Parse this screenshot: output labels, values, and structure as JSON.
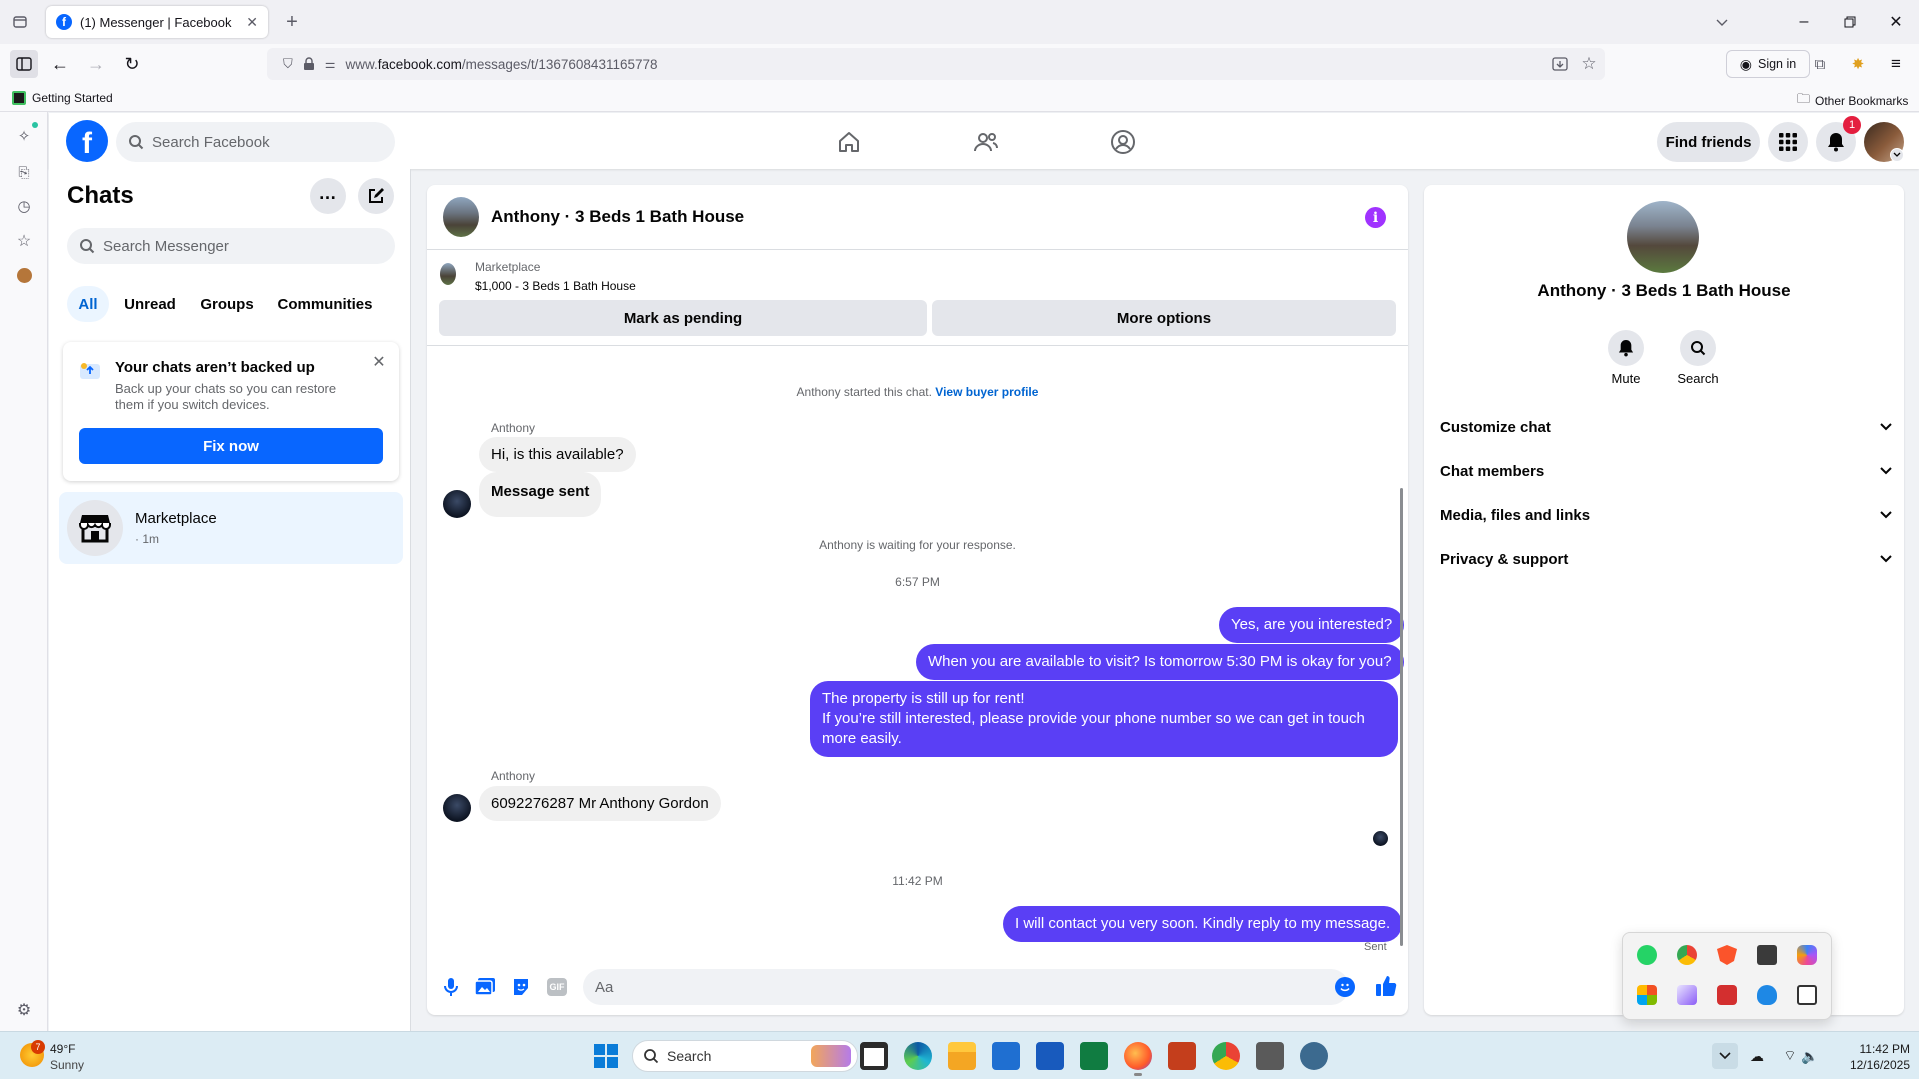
{
  "browser": {
    "tab_title": "(1) Messenger | Facebook",
    "url_prefix": "www.",
    "url_host": "facebook.com",
    "url_path": "/messages/t/1367608431165778",
    "sign_in": "Sign in",
    "bookmark_getting_started": "Getting Started",
    "bookmark_other": "Other Bookmarks"
  },
  "fb_header": {
    "search_placeholder": "Search Facebook",
    "find_friends": "Find friends",
    "notification_count": "1"
  },
  "chats": {
    "title": "Chats",
    "search_placeholder": "Search Messenger",
    "filters": [
      "All",
      "Unread",
      "Groups",
      "Communities"
    ],
    "backup_card": {
      "title": "Your chats aren’t backed up",
      "description": "Back up your chats so you can restore them if you switch devices.",
      "button": "Fix now"
    },
    "list": [
      {
        "name": "Marketplace",
        "meta": "· 1m"
      }
    ]
  },
  "conversation": {
    "title": "Anthony · 3 Beds 1 Bath House",
    "marketplace_label": "Marketplace",
    "listing": "$1,000 - 3 Beds 1 Bath House",
    "mark_pending": "Mark as pending",
    "more_options": "More options",
    "started_text": "Anthony started this chat.",
    "view_buyer_profile": "View buyer profile",
    "sender_name": "Anthony",
    "msg_in_1": "Hi, is this available?",
    "msg_in_2": "Message sent",
    "waiting_text": "Anthony is waiting for your response.",
    "time_1": "6:57 PM",
    "msg_out_1": "Yes, are you interested?",
    "msg_out_2": "When you are available to visit? Is tomorrow 5:30 PM is okay for you?",
    "msg_out_3_line1": "The property is still up for rent!",
    "msg_out_3_line2": "If you’re still interested, please provide your phone number so we can get in touch more easily.",
    "sender_name_2": "Anthony",
    "msg_in_3": "6092276287 Mr Anthony Gordon",
    "time_2": "11:42 PM",
    "msg_out_4": "I will contact you very soon. Kindly reply to my message.",
    "sent_status": "Sent",
    "composer_placeholder": "Aa"
  },
  "info_panel": {
    "title": "Anthony · 3 Beds 1 Bath House",
    "mute": "Mute",
    "search": "Search",
    "sections": [
      "Customize chat",
      "Chat members",
      "Media, files and links",
      "Privacy & support"
    ]
  },
  "taskbar": {
    "weather_temp": "49°F",
    "weather_desc": "Sunny",
    "weather_badge": "7",
    "search_label": "Search",
    "time": "11:42 PM",
    "date": "12/16/2025"
  },
  "colors": {
    "fb_blue": "#0866ff",
    "bubble_out": "#5a3ff5",
    "info_purple": "#a033ff",
    "selected_chat_bg": "#ebf5ff"
  }
}
